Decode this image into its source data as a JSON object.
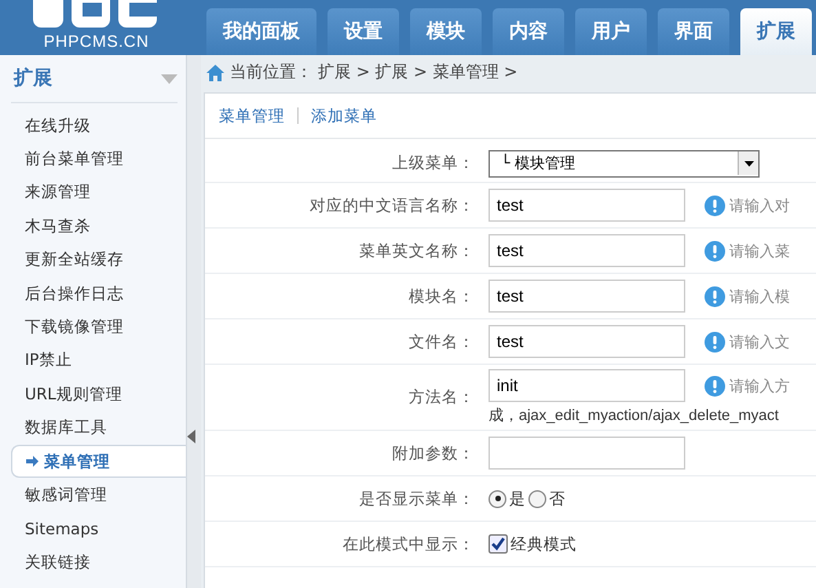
{
  "header": {
    "logo_text": "PHPCMS.CN",
    "tabs": [
      {
        "label": "我的面板",
        "selected": false
      },
      {
        "label": "设置",
        "selected": false
      },
      {
        "label": "模块",
        "selected": false
      },
      {
        "label": "内容",
        "selected": false
      },
      {
        "label": "用户",
        "selected": false
      },
      {
        "label": "界面",
        "selected": false
      },
      {
        "label": "扩展",
        "selected": true
      }
    ]
  },
  "sidebar": {
    "title": "扩展",
    "items": [
      {
        "label": "在线升级",
        "selected": false
      },
      {
        "label": "前台菜单管理",
        "selected": false
      },
      {
        "label": "来源管理",
        "selected": false
      },
      {
        "label": "木马查杀",
        "selected": false
      },
      {
        "label": "更新全站缓存",
        "selected": false
      },
      {
        "label": "后台操作日志",
        "selected": false
      },
      {
        "label": "下载镜像管理",
        "selected": false
      },
      {
        "label": "IP禁止",
        "selected": false
      },
      {
        "label": "URL规则管理",
        "selected": false
      },
      {
        "label": "数据库工具",
        "selected": false
      },
      {
        "label": "菜单管理",
        "selected": true
      },
      {
        "label": "敏感词管理",
        "selected": false
      },
      {
        "label": "Sitemaps",
        "selected": false
      },
      {
        "label": "关联链接",
        "selected": false
      }
    ]
  },
  "breadcrumb": {
    "label": "当前位置：",
    "path": "扩展 > 扩展 > 菜单管理 >"
  },
  "links": [
    "菜单管理",
    "添加菜单"
  ],
  "form": {
    "rows": [
      {
        "kind": "select",
        "label": "上级菜单：",
        "value": "└ 模块管理"
      },
      {
        "kind": "text",
        "label": "对应的中文语言名称：",
        "value": "test",
        "hint": "请输入对"
      },
      {
        "kind": "text",
        "label": "菜单英文名称：",
        "value": "test",
        "hint": "请输入菜"
      },
      {
        "kind": "text",
        "label": "模块名：",
        "value": "test",
        "hint": "请输入模"
      },
      {
        "kind": "text",
        "label": "文件名：",
        "value": "test",
        "hint": "请输入文"
      },
      {
        "kind": "text",
        "label": "方法名：",
        "value": "init",
        "hint": "请输入方",
        "note": "成，ajax_edit_myaction/ajax_delete_myact"
      },
      {
        "kind": "text",
        "label": "附加参数：",
        "value": ""
      },
      {
        "kind": "radio",
        "label": "是否显示菜单：",
        "options": [
          {
            "label": "是",
            "selected": true
          },
          {
            "label": "否",
            "selected": false
          }
        ]
      },
      {
        "kind": "checkbox",
        "label": "在此模式中显示：",
        "options": [
          {
            "label": "经典模式",
            "checked": true
          }
        ]
      }
    ]
  }
}
